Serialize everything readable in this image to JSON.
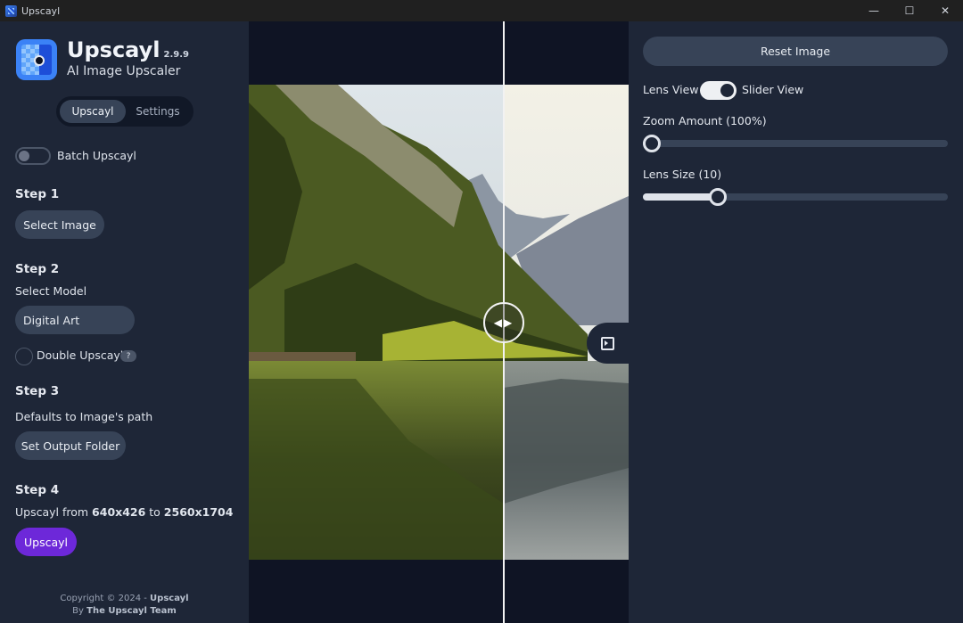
{
  "window": {
    "title": "Upscayl",
    "minimize": "—",
    "maximize": "☐",
    "close": "✕"
  },
  "brand": {
    "name": "Upscayl",
    "version": "2.9.9",
    "subtitle": "AI Image Upscaler"
  },
  "tabs": [
    {
      "label": "Upscayl",
      "active": true
    },
    {
      "label": "Settings",
      "active": false
    }
  ],
  "batch": {
    "label": "Batch Upscayl",
    "enabled": false
  },
  "step1": {
    "title": "Step 1",
    "button": "Select Image"
  },
  "step2": {
    "title": "Step 2",
    "model_label": "Select Model",
    "model_value": "Digital Art",
    "double_label": "Double Upscayl",
    "help": "?",
    "double_checked": false
  },
  "step3": {
    "title": "Step 3",
    "description": "Defaults to Image's path",
    "button": "Set Output Folder"
  },
  "step4": {
    "title": "Step 4",
    "from_prefix": "Upscayl from ",
    "from_size": "640x426",
    "to_word": " to ",
    "to_size": "2560x1704",
    "button": "Upscayl"
  },
  "footer": {
    "line1_prefix": "Copyright © 2024 - ",
    "line1_brand": "Upscayl",
    "line2_prefix": "By ",
    "line2_team": "The Upscayl Team"
  },
  "compare": {
    "handle_icon": "◀▶",
    "panel_toggle_icon": "panel-collapse-icon"
  },
  "right_panel": {
    "reset_button": "Reset Image",
    "view_left": "Lens View",
    "view_right": "Slider View",
    "slider_view_active": true,
    "zoom_label": "Zoom Amount (100%)",
    "zoom_fraction": 0.0,
    "lens_label": "Lens Size (10)",
    "lens_fraction": 0.23
  },
  "colors": {
    "accent_purple": "#6d28d9",
    "sidebar_bg": "#1e2637",
    "button_bg": "#374357"
  }
}
